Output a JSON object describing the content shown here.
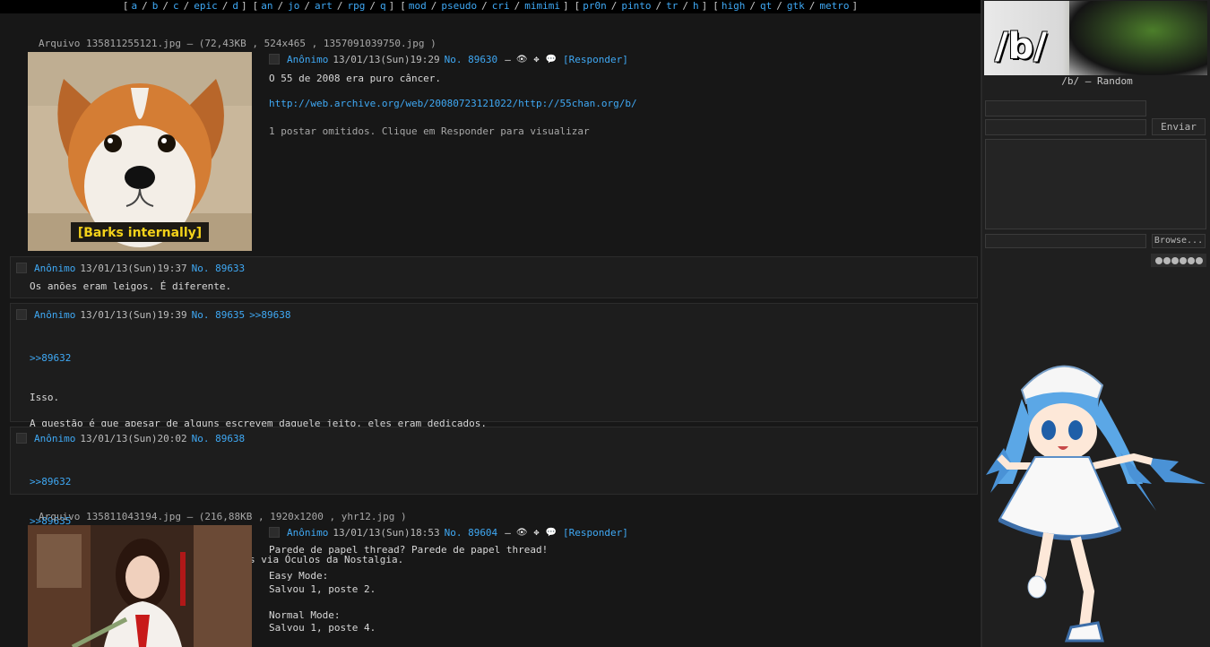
{
  "nav": {
    "groups": [
      [
        "a",
        "b",
        "c",
        "epic",
        "d"
      ],
      [
        "an",
        "jo",
        "art",
        "rpg",
        "q"
      ],
      [
        "mod",
        "pseudo",
        "cri",
        "mimimi"
      ],
      [
        "pr0n",
        "pinto",
        "tr",
        "h"
      ],
      [
        "high",
        "qt",
        "gtk",
        "metro"
      ]
    ]
  },
  "thread1": {
    "fileinfo": "Arquivo 135811255121.jpg – (72,43KB , 524x465 , 1357091039750.jpg )",
    "thumb_caption": "[Barks internally]",
    "op": {
      "name": "Anônimo",
      "date": "13/01/13(Sun)19:29",
      "no": "No. 89630",
      "dash": "–",
      "reply_link": "[Responder]",
      "text": "O 55 de 2008 era puro câncer.",
      "link": "http://web.archive.org/web/20080723121022/http://55chan.org/b/",
      "omitted": "1 postar omitidos. Clique em Responder para visualizar"
    },
    "replies": [
      {
        "name": "Anônimo",
        "date": "13/01/13(Sun)19:37",
        "no": "No. 89633",
        "backlink": "",
        "quotes": [],
        "text": "Os anões eram leigos. É diferente."
      },
      {
        "name": "Anônimo",
        "date": "13/01/13(Sun)19:39",
        "no": "No. 89635",
        "backlink": ">>89638",
        "quotes": [
          ">>89632"
        ],
        "text": "Isso.\n\nA questão é que apesar de alguns escrevem daquele jeito, eles eram dedicados.\nE tudo era muito novo, pessoal vindo do PICA DE BIBA, do Outter space, era uma época onde chans eram para pessoas diferentes, onde as pessoas tinham disposição para\nraids e para deixar seu rastro.\nEra uma época boa."
      },
      {
        "name": "Anônimo",
        "date": "13/01/13(Sun)20:02",
        "no": "No. 89638",
        "backlink": "",
        "quotes": [
          ">>89632",
          ">>89635"
        ],
        "text": "Acho que vocês estão olhando as coisas via Óculos da Nostalgia."
      }
    ]
  },
  "thread2": {
    "fileinfo": "Arquivo 135811043194.jpg – (216,88KB , 1920x1200 , yhr12.jpg )",
    "op": {
      "name": "Anônimo",
      "date": "13/01/13(Sun)18:53",
      "no": "No. 89604",
      "dash": "–",
      "reply_link": "[Responder]",
      "text": "Parede de papel thread? Parede de papel thread!\n\nEasy Mode:\nSalvou 1, poste 2.\n\nNormal Mode:\nSalvou 1, poste 4."
    }
  },
  "sidebar": {
    "banner_text": "/b/",
    "board_title": "/b/ – Random",
    "submit_label": "Enviar",
    "browse_label": "Browse..."
  },
  "colors": {
    "link": "#3fa9f5",
    "background": "#171717",
    "reply_bg": "#1d1d1d"
  }
}
